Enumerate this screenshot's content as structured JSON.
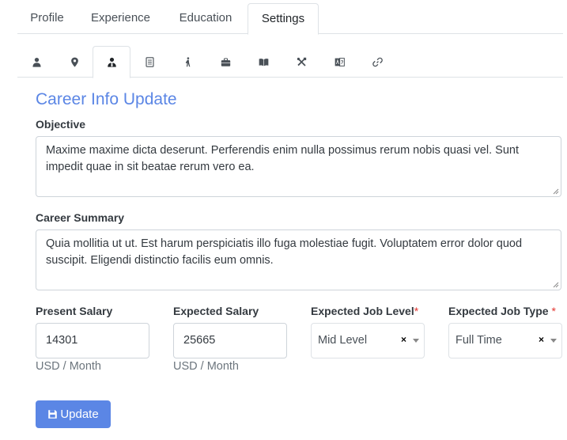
{
  "top_tabs": [
    {
      "label": "Profile"
    },
    {
      "label": "Experience"
    },
    {
      "label": "Education"
    },
    {
      "label": "Settings",
      "active": true
    }
  ],
  "icon_tabs": [
    {
      "icon": "user-icon"
    },
    {
      "icon": "map-marker-icon"
    },
    {
      "icon": "user-tie-icon",
      "active": true
    },
    {
      "icon": "document-icon"
    },
    {
      "icon": "walking-icon"
    },
    {
      "icon": "briefcase-icon"
    },
    {
      "icon": "book-open-icon"
    },
    {
      "icon": "tools-icon"
    },
    {
      "icon": "language-icon"
    },
    {
      "icon": "link-icon"
    }
  ],
  "form": {
    "title": "Career Info Update",
    "objective": {
      "label": "Objective",
      "value": "Maxime maxime dicta deserunt. Perferendis enim nulla possimus rerum nobis quasi vel. Sunt impedit quae in sit beatae rerum vero ea."
    },
    "career_summary": {
      "label": "Career Summary",
      "value": "Quia mollitia ut ut. Est harum perspiciatis illo fuga molestiae fugit. Voluptatem error dolor quod suscipit. Eligendi distinctio facilis eum omnis."
    },
    "present_salary": {
      "label": "Present Salary",
      "value": "14301",
      "unit": "USD / Month"
    },
    "expected_salary": {
      "label": "Expected Salary",
      "value": "25665",
      "unit": "USD / Month"
    },
    "expected_job_level": {
      "label": "Expected Job Level",
      "required_mark": "*",
      "value": "Mid Level",
      "clear": "×"
    },
    "expected_job_type": {
      "label": "Expected Job Type",
      "required_mark": "*",
      "value": "Full Time",
      "clear": "×"
    },
    "submit_label": "Update"
  },
  "colors": {
    "accent": "#5b86e5",
    "required": "#e3342f",
    "border": "#dee2e6"
  }
}
